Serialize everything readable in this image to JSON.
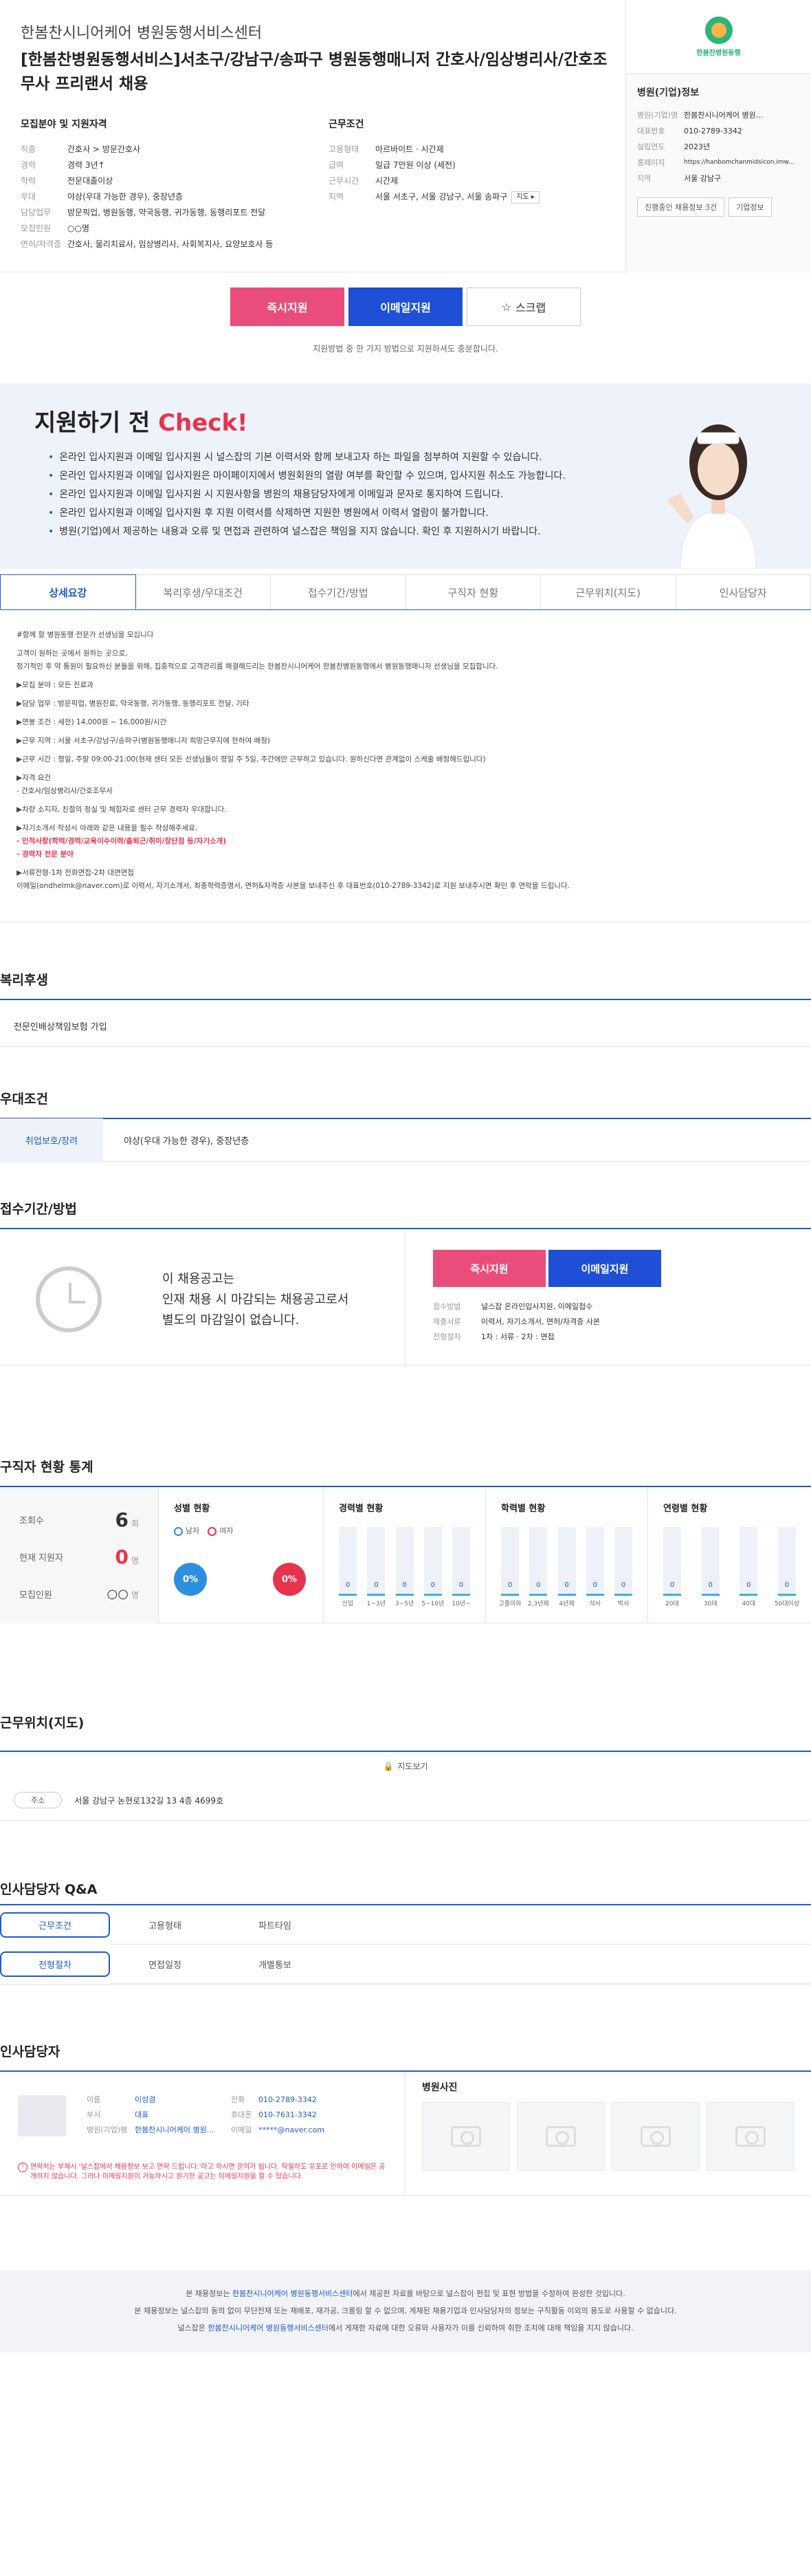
{
  "header": {
    "company": "한봄찬시니어케어 병원동행서비스센터",
    "title": "[한봄찬병원동행서비스]서초구/강남구/송파구 병원동행매니저 간호사/임상병리사/간호조무사 프리랜서 채용"
  },
  "recruit": {
    "heading": "모집분야 및 지원자격",
    "rows": [
      {
        "k": "직종",
        "v": "간호사 > 방문간호사"
      },
      {
        "k": "경력",
        "v": "경력 3년↑"
      },
      {
        "k": "학력",
        "v": "전문대졸이상"
      },
      {
        "k": "우대",
        "v": "야상(우대 가능한 경우), 중장년층"
      },
      {
        "k": "담당업무",
        "v": "방문픽업, 병원동행, 약국동행, 귀가동행, 동행리포트 전달"
      },
      {
        "k": "모집인원",
        "v": "○○명"
      },
      {
        "k": "면허/자격증",
        "v": "간호사, 물리치료사, 임상병리사, 사회복지사, 요양보호사 등"
      }
    ]
  },
  "conditions": {
    "heading": "근무조건",
    "rows": [
      {
        "k": "고용형태",
        "v": "아르바이트 · 시간제"
      },
      {
        "k": "급여",
        "v": "일급 7만원 이상 (세전)"
      },
      {
        "k": "근무시간",
        "v": "시간제"
      },
      {
        "k": "지역",
        "v": "서울 서초구, 서울 강남구, 서울 송파구"
      }
    ],
    "more": "지도"
  },
  "company_info": {
    "logo_text": "한봄찬병원동행",
    "heading": "병원(기업)정보",
    "rows": [
      {
        "k": "병원(기업)명",
        "v": "한봄찬시니어케어 병원..."
      },
      {
        "k": "대표번호",
        "v": "010-2789-3342"
      },
      {
        "k": "설립연도",
        "v": "2023년"
      },
      {
        "k": "홈페이지",
        "v": "https://hanbomchanmidsicon.imw..."
      },
      {
        "k": "지역",
        "v": "서울 강남구"
      }
    ],
    "btn_jobs_prefix": "진행중인 채용정보 ",
    "btn_jobs_count": "3",
    "btn_jobs_suffix": "건",
    "btn_company": "기업정보"
  },
  "apply": {
    "instant": "즉시지원",
    "email": "이메일지원",
    "scrap": "스크랩",
    "note": "지원방법 중 한 가지 방법으로 지원하셔도 충분합니다."
  },
  "check": {
    "title_prefix": "지원하기 전 ",
    "title_check": "Check!",
    "items": [
      "온라인 입사지원과 이메일 입사지원 시 널스잡의 기본 이력서와 함께 보내고자 하는 파일을 첨부하여 지원할 수 있습니다.",
      "온라인 입사지원과 이메일 입사지원은 마이페이지에서 병원회원의 열람 여부를 확인할 수 있으며, 입사지원 취소도 가능합니다.",
      "온라인 입사지원과 이메일 입사지원 시 지원사항을 병원의 채용담당자에게 이메일과 문자로 통지하여 드립니다.",
      "온라인 입사지원과 이메일 입사지원 후 지원 이력서를 삭제하면 지원한 병원에서 이력서 열람이 불가합니다.",
      "병원(기업)에서 제공하는 내용과 오류 및 면접과 관련하여 널스잡은 책임을 지지 않습니다. 확인 후 지원하시기 바랍니다."
    ]
  },
  "tabs": [
    "상세요강",
    "복리후생/우대조건",
    "접수기간/방법",
    "구직자 현황",
    "근무위치(지도)",
    "인사담당자"
  ],
  "detail": {
    "lines": [
      "#함께 할 병원동행 전문가 선생님을 모십니다",
      "고객이 원하는 곳에서 원하는 곳으로,",
      "정기적인 후 약 통원이 필요하신 분들을 위해, 집중적으로 고객관리를 해결해드리는 한봄찬시니어케어 한봄찬병원동행에서 병원동행매니저 선생님을 모집합니다.",
      "▶모집 분야 : 모든 진료과",
      "▶담당 업무 : 방문픽업, 병원진료, 약국동행, 귀가동행, 동행리포트 전달, 기타",
      "▶연봉 조건 : 세전) 14,000원 ~ 16,000원/시간",
      "▶근무 지역 : 서울 서초구/강남구/송파구(병원동행매니저 희망근무지에 한하여 배정)",
      "▶근무 시간 : 평일, 주말 09:00-21:00(현재 센터 모든 선생님들이 평일 주 5일, 주간에만 근무하고 있습니다. 원하신다면 관계없이 스케줄 배정해드립니다)",
      "▶자격 요건",
      "- 간호사/임상병리사/간호조무사",
      "▶차량 소지자, 친절의 정실 및 체험자로 센터 근무 경력자 우대합니다.",
      "▶자기소개서 작성시 아래와 같은 내용을 필수 작성해주세요."
    ],
    "warn1": "- 인적사항(학력/경력/교육이수이력/출퇴근/취미/장단점 등/자기소개)",
    "warn2": "- 경력자 전문 분야",
    "foot1": "▶서류전형-1차 전화면접-2차 대면면접",
    "foot2": "이메일(ondhelmk@naver.com)로 이력서, 자기소개서, 최종학력증명서, 면허&자격증 사본을 보내주신 후 대표번호(010-2789-3342)로 지원 보내주시면 확인 후 연락을 드립니다."
  },
  "benefit": {
    "title": "복리후생",
    "value": "전문인배상책임보험 가입"
  },
  "treat": {
    "title": "우대조건",
    "key": "취업보호/장려",
    "value": "야상(우대 가능한 경우), 중장년층"
  },
  "receive": {
    "title": "접수기간/방법",
    "line1": "이 채용공고는",
    "line2": "인재 채용 시 마감되는 채용공고로서",
    "line3": "별도의 마감일이 없습니다.",
    "instant": "즉시지원",
    "email": "이메일지원",
    "rows": [
      {
        "k": "접수방법",
        "v": "널스잡 온라인입사지원, 이메일접수"
      },
      {
        "k": "제출서류",
        "v": "이력서, 자기소개서, 면허/자격증 사본"
      },
      {
        "k": "전형절차",
        "v": "1차 : 서류 · 2차 : 면접"
      }
    ]
  },
  "stats": {
    "title": "구직자 현황 통계",
    "views_label": "조회수",
    "views": "6",
    "views_unit": "회",
    "applicants_label": "현재 지원자",
    "applicants": "0",
    "applicants_unit": "명",
    "recruit_label": "모집인원",
    "recruit": "○○",
    "recruit_unit": "명",
    "gender_title": "성별 현황",
    "male": "남자",
    "female": "여자",
    "male_pct": "0%",
    "female_pct": "0%",
    "male_color": "#2c8fe0",
    "female_color": "#e8334d"
  },
  "chart_data": [
    {
      "type": "bar",
      "title": "경력별 현황",
      "categories": [
        "신입",
        "1~3년",
        "3~5년",
        "5~10년",
        "10년~"
      ],
      "values": [
        0,
        0,
        0,
        0,
        0
      ]
    },
    {
      "type": "bar",
      "title": "학력별 현황",
      "categories": [
        "고졸이하",
        "2,3년제",
        "4년제",
        "석사",
        "박사"
      ],
      "values": [
        0,
        0,
        0,
        0,
        0
      ]
    },
    {
      "type": "bar",
      "title": "연령별 현황",
      "categories": [
        "20대",
        "30대",
        "40대",
        "50대이상"
      ],
      "values": [
        0,
        0,
        0,
        0
      ]
    }
  ],
  "map": {
    "title": "근무위치(지도)",
    "btn": "지도보기",
    "tag": "주소",
    "address": "서울 강남구 논현로132길 13 4층 4699호"
  },
  "qa": {
    "title": "인사담당자 Q&A",
    "cells": [
      "근무조건",
      "고용형태",
      "파트타임",
      "",
      "전형절차",
      "면접일정",
      "개별통보",
      ""
    ]
  },
  "manager": {
    "title": "인사담당자",
    "rows": [
      {
        "k": "이름",
        "v": "이성경",
        "k2": "전화",
        "v2": "010-2789-3342"
      },
      {
        "k": "부서",
        "v": "대표",
        "k2": "휴대폰",
        "v2": "010-7631-3342"
      },
      {
        "k": "병원(기업)명",
        "v": "한봄찬시니어케어 병원...",
        "k2": "이메일",
        "v2": "*****@naver.com"
      }
    ],
    "note": "연락처는 부재시 '널스잡에서 채용정보 보고 연락 드립니다.'라고 하시면 문의가 됩니다. 탁월하도 유포로 인하여 이메일은 공개하지 않습니다. 그러나 이메일지원이 가능하시고 원기한 공고는 이메일지원을 할 수 있습니다.",
    "photo_title": "병원사진"
  },
  "footer": {
    "line1_pre": "본 채용정보는 ",
    "line1_link": "한봄찬시니어케어 병원동행서비스센터",
    "line1_post": "에서 제공한 자료를 바탕으로 널스잡이 편집 및 표현 방법을 수정하여 완성한 것입니다.",
    "line2": "본 채용정보는 널스잡의 동의 없이 무단전재 또는 재배포, 재가공, 크롤링 할 수 없으며, 게재된 채용기업과 인사담당자의 정보는 구직활동 이외의 용도로 사용할 수 없습니다.",
    "line3_pre": "널스잡은 ",
    "line3_link": "한봄찬시니어케어 병원동행서비스센터",
    "line3_post": "에서 게재한 자료에 대한 오류와 사용자가 이를 신뢰하여 취한 조치에 대해 책임을 지지 않습니다."
  }
}
